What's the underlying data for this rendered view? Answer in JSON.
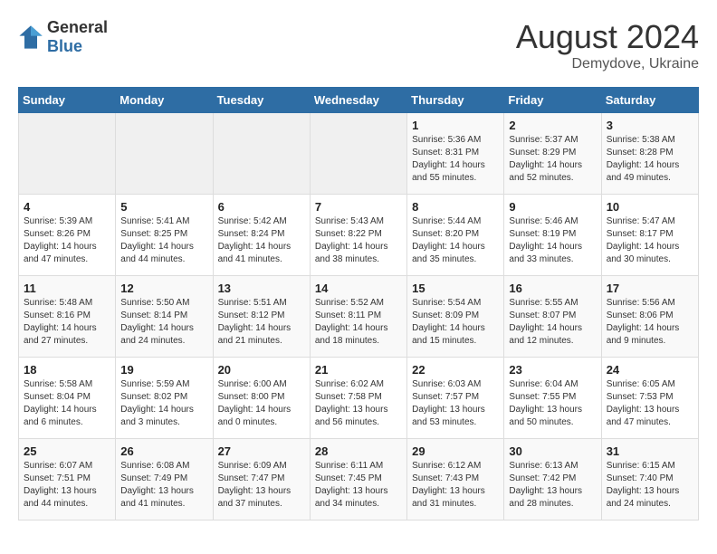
{
  "logo": {
    "general": "General",
    "blue": "Blue"
  },
  "title": "August 2024",
  "location": "Demydove, Ukraine",
  "days_header": [
    "Sunday",
    "Monday",
    "Tuesday",
    "Wednesday",
    "Thursday",
    "Friday",
    "Saturday"
  ],
  "weeks": [
    [
      {
        "day": "",
        "sunrise": "",
        "sunset": "",
        "daylight": "",
        "empty": true
      },
      {
        "day": "",
        "sunrise": "",
        "sunset": "",
        "daylight": "",
        "empty": true
      },
      {
        "day": "",
        "sunrise": "",
        "sunset": "",
        "daylight": "",
        "empty": true
      },
      {
        "day": "",
        "sunrise": "",
        "sunset": "",
        "daylight": "",
        "empty": true
      },
      {
        "day": "1",
        "sunrise": "Sunrise: 5:36 AM",
        "sunset": "Sunset: 8:31 PM",
        "daylight": "Daylight: 14 hours and 55 minutes."
      },
      {
        "day": "2",
        "sunrise": "Sunrise: 5:37 AM",
        "sunset": "Sunset: 8:29 PM",
        "daylight": "Daylight: 14 hours and 52 minutes."
      },
      {
        "day": "3",
        "sunrise": "Sunrise: 5:38 AM",
        "sunset": "Sunset: 8:28 PM",
        "daylight": "Daylight: 14 hours and 49 minutes."
      }
    ],
    [
      {
        "day": "4",
        "sunrise": "Sunrise: 5:39 AM",
        "sunset": "Sunset: 8:26 PM",
        "daylight": "Daylight: 14 hours and 47 minutes."
      },
      {
        "day": "5",
        "sunrise": "Sunrise: 5:41 AM",
        "sunset": "Sunset: 8:25 PM",
        "daylight": "Daylight: 14 hours and 44 minutes."
      },
      {
        "day": "6",
        "sunrise": "Sunrise: 5:42 AM",
        "sunset": "Sunset: 8:24 PM",
        "daylight": "Daylight: 14 hours and 41 minutes."
      },
      {
        "day": "7",
        "sunrise": "Sunrise: 5:43 AM",
        "sunset": "Sunset: 8:22 PM",
        "daylight": "Daylight: 14 hours and 38 minutes."
      },
      {
        "day": "8",
        "sunrise": "Sunrise: 5:44 AM",
        "sunset": "Sunset: 8:20 PM",
        "daylight": "Daylight: 14 hours and 35 minutes."
      },
      {
        "day": "9",
        "sunrise": "Sunrise: 5:46 AM",
        "sunset": "Sunset: 8:19 PM",
        "daylight": "Daylight: 14 hours and 33 minutes."
      },
      {
        "day": "10",
        "sunrise": "Sunrise: 5:47 AM",
        "sunset": "Sunset: 8:17 PM",
        "daylight": "Daylight: 14 hours and 30 minutes."
      }
    ],
    [
      {
        "day": "11",
        "sunrise": "Sunrise: 5:48 AM",
        "sunset": "Sunset: 8:16 PM",
        "daylight": "Daylight: 14 hours and 27 minutes."
      },
      {
        "day": "12",
        "sunrise": "Sunrise: 5:50 AM",
        "sunset": "Sunset: 8:14 PM",
        "daylight": "Daylight: 14 hours and 24 minutes."
      },
      {
        "day": "13",
        "sunrise": "Sunrise: 5:51 AM",
        "sunset": "Sunset: 8:12 PM",
        "daylight": "Daylight: 14 hours and 21 minutes."
      },
      {
        "day": "14",
        "sunrise": "Sunrise: 5:52 AM",
        "sunset": "Sunset: 8:11 PM",
        "daylight": "Daylight: 14 hours and 18 minutes."
      },
      {
        "day": "15",
        "sunrise": "Sunrise: 5:54 AM",
        "sunset": "Sunset: 8:09 PM",
        "daylight": "Daylight: 14 hours and 15 minutes."
      },
      {
        "day": "16",
        "sunrise": "Sunrise: 5:55 AM",
        "sunset": "Sunset: 8:07 PM",
        "daylight": "Daylight: 14 hours and 12 minutes."
      },
      {
        "day": "17",
        "sunrise": "Sunrise: 5:56 AM",
        "sunset": "Sunset: 8:06 PM",
        "daylight": "Daylight: 14 hours and 9 minutes."
      }
    ],
    [
      {
        "day": "18",
        "sunrise": "Sunrise: 5:58 AM",
        "sunset": "Sunset: 8:04 PM",
        "daylight": "Daylight: 14 hours and 6 minutes."
      },
      {
        "day": "19",
        "sunrise": "Sunrise: 5:59 AM",
        "sunset": "Sunset: 8:02 PM",
        "daylight": "Daylight: 14 hours and 3 minutes."
      },
      {
        "day": "20",
        "sunrise": "Sunrise: 6:00 AM",
        "sunset": "Sunset: 8:00 PM",
        "daylight": "Daylight: 14 hours and 0 minutes."
      },
      {
        "day": "21",
        "sunrise": "Sunrise: 6:02 AM",
        "sunset": "Sunset: 7:58 PM",
        "daylight": "Daylight: 13 hours and 56 minutes."
      },
      {
        "day": "22",
        "sunrise": "Sunrise: 6:03 AM",
        "sunset": "Sunset: 7:57 PM",
        "daylight": "Daylight: 13 hours and 53 minutes."
      },
      {
        "day": "23",
        "sunrise": "Sunrise: 6:04 AM",
        "sunset": "Sunset: 7:55 PM",
        "daylight": "Daylight: 13 hours and 50 minutes."
      },
      {
        "day": "24",
        "sunrise": "Sunrise: 6:05 AM",
        "sunset": "Sunset: 7:53 PM",
        "daylight": "Daylight: 13 hours and 47 minutes."
      }
    ],
    [
      {
        "day": "25",
        "sunrise": "Sunrise: 6:07 AM",
        "sunset": "Sunset: 7:51 PM",
        "daylight": "Daylight: 13 hours and 44 minutes."
      },
      {
        "day": "26",
        "sunrise": "Sunrise: 6:08 AM",
        "sunset": "Sunset: 7:49 PM",
        "daylight": "Daylight: 13 hours and 41 minutes."
      },
      {
        "day": "27",
        "sunrise": "Sunrise: 6:09 AM",
        "sunset": "Sunset: 7:47 PM",
        "daylight": "Daylight: 13 hours and 37 minutes."
      },
      {
        "day": "28",
        "sunrise": "Sunrise: 6:11 AM",
        "sunset": "Sunset: 7:45 PM",
        "daylight": "Daylight: 13 hours and 34 minutes."
      },
      {
        "day": "29",
        "sunrise": "Sunrise: 6:12 AM",
        "sunset": "Sunset: 7:43 PM",
        "daylight": "Daylight: 13 hours and 31 minutes."
      },
      {
        "day": "30",
        "sunrise": "Sunrise: 6:13 AM",
        "sunset": "Sunset: 7:42 PM",
        "daylight": "Daylight: 13 hours and 28 minutes."
      },
      {
        "day": "31",
        "sunrise": "Sunrise: 6:15 AM",
        "sunset": "Sunset: 7:40 PM",
        "daylight": "Daylight: 13 hours and 24 minutes."
      }
    ]
  ]
}
